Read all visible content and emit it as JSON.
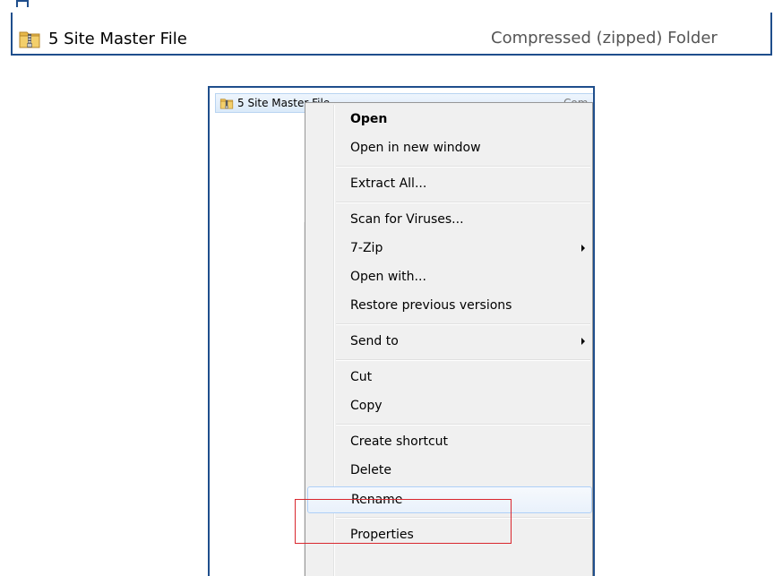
{
  "top_row": {
    "file_name": "5 Site Master File",
    "file_type": "Compressed (zipped) Folder"
  },
  "explorer": {
    "file_name": "5 Site Master File",
    "file_type": "Com"
  },
  "context_menu": {
    "items": [
      {
        "label": "Open",
        "bold": true
      },
      {
        "label": "Open in new window"
      },
      {
        "label": "Extract All..."
      },
      {
        "label": "Scan for Viruses..."
      },
      {
        "label": "7-Zip",
        "submenu": true
      },
      {
        "label": "Open with..."
      },
      {
        "label": "Restore previous versions"
      },
      {
        "label": "Send to",
        "submenu": true
      },
      {
        "label": "Cut"
      },
      {
        "label": "Copy"
      },
      {
        "label": "Create shortcut"
      },
      {
        "label": "Delete"
      },
      {
        "label": "Rename",
        "highlighted": true
      },
      {
        "label": "Properties"
      }
    ]
  },
  "icons": {
    "zip_folder": "zip-folder-icon",
    "submenu_arrow": "chevron-right-icon"
  },
  "colors": {
    "frame_border": "#1f4e8c",
    "highlight_box": "#d9272e",
    "menu_bg": "#f0f0f0",
    "hover_border": "#aecff7"
  }
}
